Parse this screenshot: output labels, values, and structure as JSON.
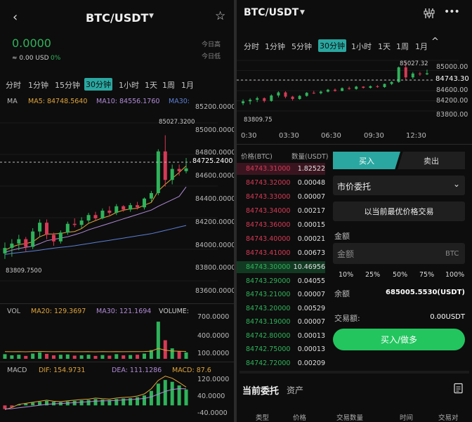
{
  "colors": {
    "up": "#2fb35a",
    "down": "#d63a55",
    "accent": "#2aa7a0",
    "bg": "#0d0d0d",
    "ma5": "#e0a43a",
    "ma10": "#b18bd8",
    "ma30": "#5b7fd6",
    "bright_green": "#22c55e"
  },
  "left": {
    "header": {
      "back_icon": "back-arrow-icon",
      "title": "BTC/USDT",
      "dropdown_icon": "triangle-down-icon",
      "star_icon": "star-icon"
    },
    "price": {
      "last": "0.0000",
      "approx": "≈ 0.00 USD",
      "change": "0%",
      "high_label": "今日高",
      "low_label": "今日低"
    },
    "timeframes": [
      "分时",
      "1分钟",
      "15分钟",
      "30分钟",
      "1小时",
      "1天",
      "1周",
      "1月"
    ],
    "selected_timeframe": "30分钟",
    "ma_line": {
      "title": "MA",
      "ma5": "MA5: 84748.5640",
      "ma10": "MA10: 84556.1760",
      "ma30": "MA30:"
    },
    "price_axis": [
      "85200.0000",
      "85000.0000",
      "84800.0000",
      "84600.0000",
      "84400.0000",
      "84200.0000",
      "84000.0000",
      "83800.0000",
      "83600.0000"
    ],
    "current_price_tag": "84725.2400",
    "high_annotation": "85027.3200",
    "low_annotation": "83809.7500",
    "vol_line": {
      "title": "VOL",
      "ma20": "MA20: 129.3697",
      "ma30": "MA30: 121.1694",
      "volume": "VOLUME:"
    },
    "vol_axis": [
      "700.0000",
      "400.0000",
      "100.0000"
    ],
    "macd_line": {
      "title": "MACD",
      "dif": "DIF: 154.9731",
      "dea": "DEA: 111.1286",
      "macd": "MACD: 87.6"
    },
    "macd_axis": [
      "120.0000",
      "40.0000",
      "-40.0000"
    ]
  },
  "right": {
    "header": {
      "title": "BTC/USDT",
      "dropdown_icon": "triangle-down-icon",
      "settings_icon": "chart-settings-icon",
      "more_icon": "more-icon"
    },
    "timeframes": [
      "分时",
      "1分钟",
      "5分钟",
      "30分钟",
      "1小时",
      "1天",
      "1周",
      "1月"
    ],
    "selected_timeframe": "30分钟",
    "collapse_icon": "chevron-up-icon",
    "price_axis": [
      "85000.00",
      "84600.00",
      "84200.00",
      "83800.00"
    ],
    "current_price_tag": "84743.30",
    "high_annotation": "85027.32",
    "low_annotation": "83809.75",
    "time_axis": [
      "0:30",
      "03:30",
      "06:30",
      "09:30",
      "12:30"
    ],
    "orderbook": {
      "header_price": "价格(BTC)",
      "header_qty": "数量(USDT)",
      "asks": [
        {
          "price": "84743.31000",
          "qty": "1.82522"
        },
        {
          "price": "84743.32000",
          "qty": "0.00048"
        },
        {
          "price": "84743.33000",
          "qty": "0.00007"
        },
        {
          "price": "84743.34000",
          "qty": "0.00217"
        },
        {
          "price": "84743.36000",
          "qty": "0.00015"
        },
        {
          "price": "84743.40000",
          "qty": "0.00021"
        },
        {
          "price": "84743.41000",
          "qty": "0.00673"
        },
        {
          "price": "84743.42000",
          "qty": "0.00007"
        }
      ],
      "bids": [
        {
          "price": "84743.30000",
          "qty": "10.46956"
        },
        {
          "price": "84743.29000",
          "qty": "0.04055"
        },
        {
          "price": "84743.21000",
          "qty": "0.00007"
        },
        {
          "price": "84743.20000",
          "qty": "0.00529"
        },
        {
          "price": "84743.19000",
          "qty": "0.00007"
        },
        {
          "price": "84742.80000",
          "qty": "0.00013"
        },
        {
          "price": "84742.75000",
          "qty": "0.00013"
        },
        {
          "price": "84742.72000",
          "qty": "0.00209"
        }
      ]
    },
    "trade": {
      "buy_tab": "买入",
      "sell_tab": "卖出",
      "order_type": "市价委托",
      "best_price_button": "以当前最优价格交易",
      "amount_label": "金额",
      "amount_placeholder": "金额",
      "amount_unit": "BTC",
      "percents": [
        "10%",
        "25%",
        "50%",
        "75%",
        "100%"
      ],
      "balance_label": "余额",
      "balance_value": "685005.5530(USDT)",
      "trade_amount_label": "交易额:",
      "trade_amount_value": "0.00USDT",
      "submit_button": "买入/做多"
    },
    "orders": {
      "tab_current": "当前委托",
      "tab_assets": "资产",
      "columns": [
        "类型",
        "价格",
        "交易数量",
        "时间",
        "交易对"
      ]
    }
  },
  "chart_data": [
    {
      "type": "candlestick",
      "title": "BTC/USDT 30分钟",
      "ylim": [
        83600,
        85200
      ],
      "ohlc": [
        [
          83950,
          84050,
          83900,
          84000
        ],
        [
          84000,
          84080,
          83920,
          84040
        ],
        [
          84040,
          84120,
          83980,
          84080
        ],
        [
          84080,
          84100,
          83970,
          84010
        ],
        [
          84010,
          84180,
          83990,
          84150
        ],
        [
          84150,
          84260,
          84100,
          84230
        ],
        [
          84230,
          84260,
          84080,
          84120
        ],
        [
          84120,
          84140,
          84020,
          84060
        ],
        [
          84060,
          84160,
          84040,
          84140
        ],
        [
          84140,
          84240,
          84120,
          84220
        ],
        [
          84220,
          84270,
          84190,
          84210
        ],
        [
          84210,
          84280,
          84180,
          84250
        ],
        [
          84250,
          84320,
          84230,
          84300
        ],
        [
          84300,
          84330,
          84250,
          84270
        ],
        [
          84270,
          84360,
          84260,
          84340
        ],
        [
          84340,
          84380,
          84300,
          84320
        ],
        [
          84320,
          84400,
          84300,
          84380
        ],
        [
          84380,
          84390,
          84330,
          84350
        ],
        [
          84350,
          84410,
          84330,
          84390
        ],
        [
          84390,
          84420,
          84350,
          84370
        ],
        [
          84370,
          84460,
          84350,
          84450
        ],
        [
          84450,
          84520,
          84420,
          84500
        ],
        [
          84500,
          84900,
          84480,
          84880
        ],
        [
          84880,
          85027.32,
          84560,
          84620
        ],
        [
          84620,
          84760,
          84580,
          84720
        ],
        [
          84720,
          84760,
          84660,
          84700
        ],
        [
          84700,
          84820,
          84680,
          84725.24
        ]
      ],
      "ma5": [
        83980,
        84010,
        84030,
        84040,
        84056,
        84102,
        84126,
        84128,
        84132,
        84144,
        84150,
        84176,
        84224,
        84250,
        84274,
        84292,
        84324,
        84344,
        84356,
        84362,
        84390,
        84414,
        84520,
        84580,
        84634,
        84688,
        84748.564
      ],
      "ma10": [
        83960,
        83980,
        83995,
        84005,
        84016,
        84040,
        84066,
        84078,
        84090,
        84102,
        84120,
        84140,
        84165,
        84185,
        84205,
        84225,
        84245,
        84265,
        84285,
        84305,
        84325,
        84345,
        84380,
        84410,
        84440,
        84470,
        84556.176
      ],
      "ma30": [
        83940,
        83950,
        83958,
        83965,
        83972,
        83980,
        83990,
        83998,
        84005,
        84012,
        84020,
        84030,
        84040,
        84050,
        84060,
        84070,
        84080,
        84090,
        84100,
        84110,
        84120,
        84130,
        84145,
        84160,
        84175,
        84190,
        84205
      ]
    },
    {
      "type": "bar",
      "title": "VOL",
      "ylim": [
        0,
        750
      ],
      "values": [
        80,
        60,
        70,
        50,
        90,
        110,
        85,
        60,
        70,
        75,
        55,
        60,
        70,
        50,
        65,
        55,
        80,
        60,
        65,
        70,
        90,
        150,
        640,
        320,
        180,
        130,
        110
      ],
      "ma20": 129.3697,
      "ma30": 121.1694
    },
    {
      "type": "bar",
      "title": "MACD",
      "ylim": [
        -80,
        160
      ],
      "values": [
        -20,
        -10,
        5,
        10,
        15,
        20,
        25,
        20,
        18,
        22,
        25,
        28,
        30,
        35,
        32,
        30,
        35,
        38,
        40,
        45,
        55,
        80,
        120,
        140,
        130,
        110,
        87.6
      ],
      "dif": 154.9731,
      "dea": 111.1286
    }
  ]
}
